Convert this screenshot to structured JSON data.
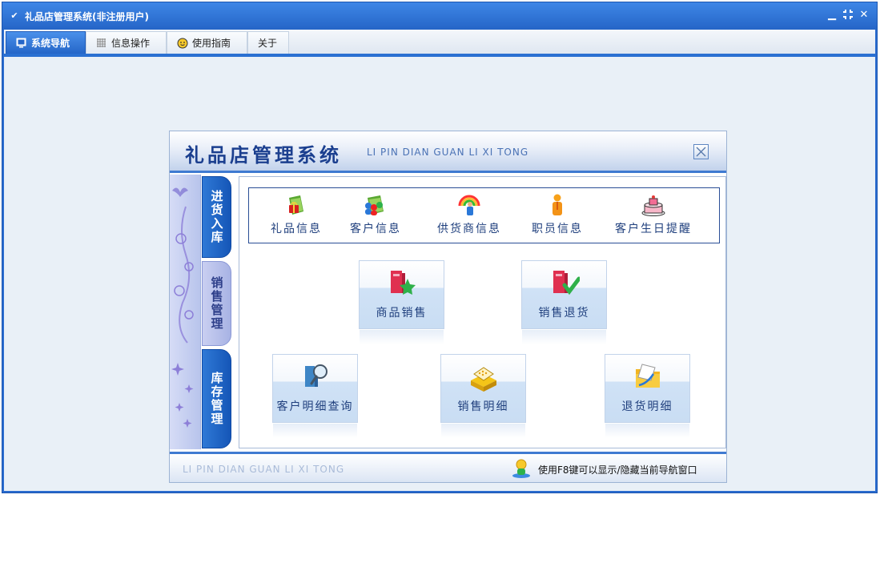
{
  "window": {
    "title": "礼品店管理系统(非注册用户)",
    "controls": [
      "minimize-icon",
      "restore-icon",
      "close-icon"
    ]
  },
  "menu": {
    "tabs": [
      {
        "label": "系统导航",
        "icon": "monitor-icon",
        "active": true
      },
      {
        "label": "信息操作",
        "icon": "grid-icon",
        "active": false
      },
      {
        "label": "使用指南",
        "icon": "smiley-icon",
        "active": false
      },
      {
        "label": "关于",
        "icon": "",
        "active": false
      }
    ]
  },
  "nav": {
    "title": "礼品店管理系统",
    "pinyin": "LI PIN DIAN GUAN LI XI TONG",
    "side_tabs": [
      {
        "label": "进货入库",
        "active": false
      },
      {
        "label": "销售管理",
        "active": true
      },
      {
        "label": "库存管理",
        "active": false
      }
    ],
    "quick_links": [
      {
        "label": "礼品信息",
        "icon": "gift-folder-icon"
      },
      {
        "label": "客户信息",
        "icon": "customer-folder-icon"
      },
      {
        "label": "供货商信息",
        "icon": "supplier-icon"
      },
      {
        "label": "职员信息",
        "icon": "staff-icon"
      },
      {
        "label": "客户生日提醒",
        "icon": "birthday-cake-icon"
      }
    ],
    "buttons": [
      {
        "label": "商品销售",
        "icon": "sales-book-icon"
      },
      {
        "label": "销售退货",
        "icon": "return-book-icon"
      },
      {
        "label": "客户明细查询",
        "icon": "search-book-icon"
      },
      {
        "label": "销售明细",
        "icon": "cash-register-icon"
      },
      {
        "label": "退货明细",
        "icon": "return-folder-icon"
      }
    ],
    "footer_pinyin": "LI PIN DIAN GUAN LI XI TONG",
    "footer_hint": "使用F8键可以显示/隐藏当前导航窗口"
  },
  "colors": {
    "titlebar": "#2a6ccf",
    "active_tab": "#2566c8",
    "nav_title": "#1b3f8f",
    "link_text": "#1f3f7d"
  }
}
